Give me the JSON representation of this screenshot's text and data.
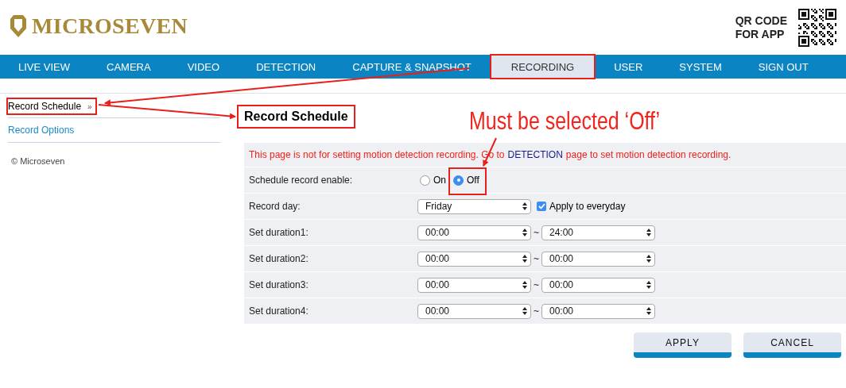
{
  "logo": {
    "text": "MICROSEVEN"
  },
  "qr": {
    "caption": [
      "QR CODE",
      "FOR APP"
    ]
  },
  "nav": [
    {
      "label": "LIVE VIEW",
      "selected": false,
      "highlighted": false
    },
    {
      "label": "CAMERA",
      "selected": false,
      "highlighted": false
    },
    {
      "label": "VIDEO",
      "selected": false,
      "highlighted": false
    },
    {
      "label": "DETECTION",
      "selected": false,
      "highlighted": false
    },
    {
      "label": "CAPTURE & SNAPSHOT",
      "selected": false,
      "highlighted": false
    },
    {
      "label": "RECORDING",
      "selected": true,
      "highlighted": true
    },
    {
      "label": "USER",
      "selected": false,
      "highlighted": false
    },
    {
      "label": "SYSTEM",
      "selected": false,
      "highlighted": false
    },
    {
      "label": "SIGN OUT",
      "selected": false,
      "highlighted": false
    }
  ],
  "sidebar": {
    "items": [
      {
        "label": "Record Schedule",
        "marker": "»",
        "selected": true,
        "highlighted": true
      },
      {
        "label": "Record Options",
        "selected": false,
        "highlighted": false
      }
    ],
    "footer": "© Microseven"
  },
  "page": {
    "title": "Record Schedule",
    "highlighted": true
  },
  "notice": {
    "before": "This page is not for setting motion detection recording. Go to",
    "link": "DETECTION",
    "after": "page to set motion detection recording."
  },
  "form": {
    "rows": [
      {
        "kind": "radio",
        "label": "Schedule record enable:",
        "options": [
          {
            "label": "On",
            "selected": false
          },
          {
            "label": "Off",
            "selected": true
          }
        ]
      },
      {
        "kind": "day",
        "label": "Record day:",
        "value": "Friday",
        "checkbox": {
          "label": "Apply to everyday",
          "checked": true
        }
      },
      {
        "kind": "duration",
        "label": "Set duration1:",
        "start": "00:00",
        "separator": "~",
        "end": "24:00"
      },
      {
        "kind": "duration",
        "label": "Set duration2:",
        "start": "00:00",
        "separator": "~",
        "end": "00:00"
      },
      {
        "kind": "duration",
        "label": "Set duration3:",
        "start": "00:00",
        "separator": "~",
        "end": "00:00"
      },
      {
        "kind": "duration",
        "label": "Set duration4:",
        "start": "00:00",
        "separator": "~",
        "end": "00:00"
      }
    ]
  },
  "buttons": [
    "APPLY",
    "CANCEL"
  ],
  "annotation": {
    "text": "Must be selected ‘Off’"
  }
}
